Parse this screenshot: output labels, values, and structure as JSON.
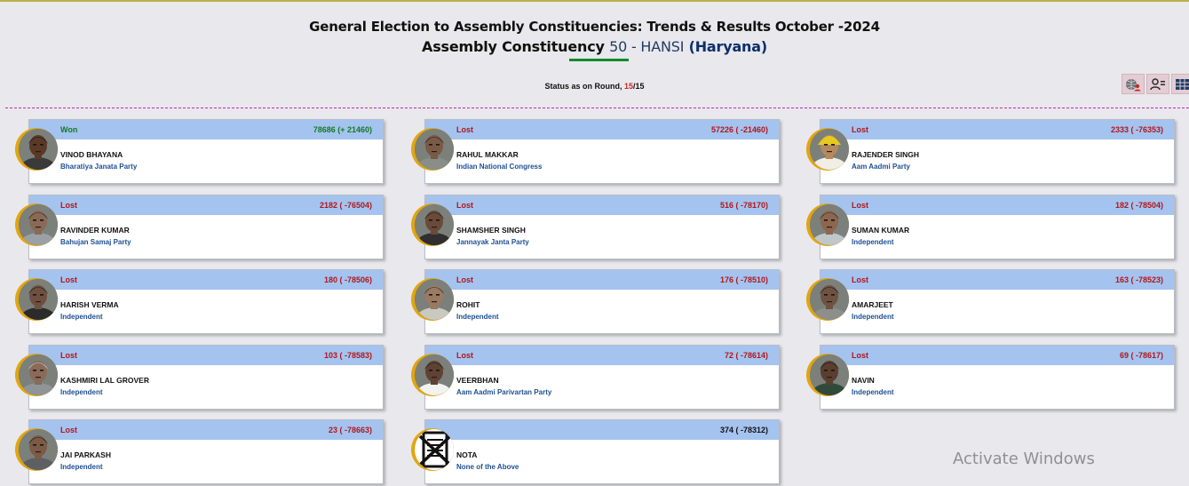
{
  "header": {
    "title": "General Election to Assembly Constituencies: Trends & Results October -2024",
    "ac_prefix": "Assembly Constituency",
    "ac_number": "50",
    "ac_separator": " - ",
    "ac_name": "HANSI",
    "state": "(Haryana)"
  },
  "status": {
    "label": "Status as on Round,",
    "current": "15",
    "total": "/15"
  },
  "toolbar": [
    {
      "icon": "globe-user-icon"
    },
    {
      "icon": "user-list-icon"
    },
    {
      "icon": "table-grid-icon"
    }
  ],
  "candidates": [
    {
      "status": "Won",
      "votes": "78686 (+ 21460)",
      "name": "VINOD BHAYANA",
      "party": "Bharatiya Janata Party",
      "skin": "#5a3a26",
      "shirt": "#3a3a3a",
      "hair": "#1c1410",
      "turban": ""
    },
    {
      "status": "Lost",
      "votes": "57226 ( -21460)",
      "name": "RAHUL MAKKAR",
      "party": "Indian National Congress",
      "skin": "#7a5a45",
      "shirt": "#8a8d88",
      "hair": "#1e1a17",
      "turban": ""
    },
    {
      "status": "Lost",
      "votes": "2333 ( -76353)",
      "name": "RAJENDER SINGH",
      "party": "Aam Aadmi Party",
      "skin": "#b58a5e",
      "shirt": "#f1eee6",
      "hair": "#e5d04a",
      "turban": "#e7c91f"
    },
    {
      "status": "Lost",
      "votes": "2182 ( -76504)",
      "name": "RAVINDER KUMAR",
      "party": "Bahujan Samaj Party",
      "skin": "#8b6a55",
      "shirt": "#9aa0a6",
      "hair": "#2a2520",
      "turban": ""
    },
    {
      "status": "Lost",
      "votes": "516 ( -78170)",
      "name": "SHAMSHER SINGH",
      "party": "Jannayak Janta Party",
      "skin": "#6a4a38",
      "shirt": "#2f2f2f",
      "hair": "#1a1714",
      "turban": ""
    },
    {
      "status": "Lost",
      "votes": "182 ( -78504)",
      "name": "SUMAN KUMAR",
      "party": "Independent",
      "skin": "#8d6650",
      "shirt": "#bfc6cc",
      "hair": "#2a241f",
      "turban": ""
    },
    {
      "status": "Lost",
      "votes": "180 ( -78506)",
      "name": "HARISH VERMA",
      "party": "Independent",
      "skin": "#6f5040",
      "shirt": "#2b2b2b",
      "hair": "#201b17",
      "turban": ""
    },
    {
      "status": "Lost",
      "votes": "176 ( -78510)",
      "name": "ROHIT",
      "party": "Independent",
      "skin": "#9a7a62",
      "shirt": "#c9c9c2",
      "hair": "#2a241f",
      "turban": ""
    },
    {
      "status": "Lost",
      "votes": "163 ( -78523)",
      "name": "AMARJEET",
      "party": "Independent",
      "skin": "#6e5242",
      "shirt": "#8c8f8a",
      "hair": "#1b1714",
      "turban": ""
    },
    {
      "status": "Lost",
      "votes": "103 ( -78583)",
      "name": "KASHMIRI LAL GROVER",
      "party": "Independent",
      "skin": "#8a6a58",
      "shirt": "#8e9497",
      "hair": "#d7d7d2",
      "turban": ""
    },
    {
      "status": "Lost",
      "votes": "72 ( -78614)",
      "name": "VEERBHAN",
      "party": "Aam Aadmi Parivartan Party",
      "skin": "#5f4232",
      "shirt": "#f2f2ee",
      "hair": "#1a1613",
      "turban": ""
    },
    {
      "status": "Lost",
      "votes": "69 ( -78617)",
      "name": "NAVIN",
      "party": "Independent",
      "skin": "#5a3e2f",
      "shirt": "#2f4a3a",
      "hair": "#171310",
      "turban": ""
    },
    {
      "status": "Lost",
      "votes": "23 ( -78663)",
      "name": "JAI PARKASH",
      "party": "Independent",
      "skin": "#7b5a46",
      "shirt": "#5d6063",
      "hair": "#1d1915",
      "turban": ""
    },
    {
      "status": "",
      "votes": "374 ( -78312)",
      "name": "NOTA",
      "party": "None of the Above",
      "skin": "",
      "shirt": "",
      "hair": "",
      "turban": ""
    }
  ],
  "watermark": "Activate Windows"
}
